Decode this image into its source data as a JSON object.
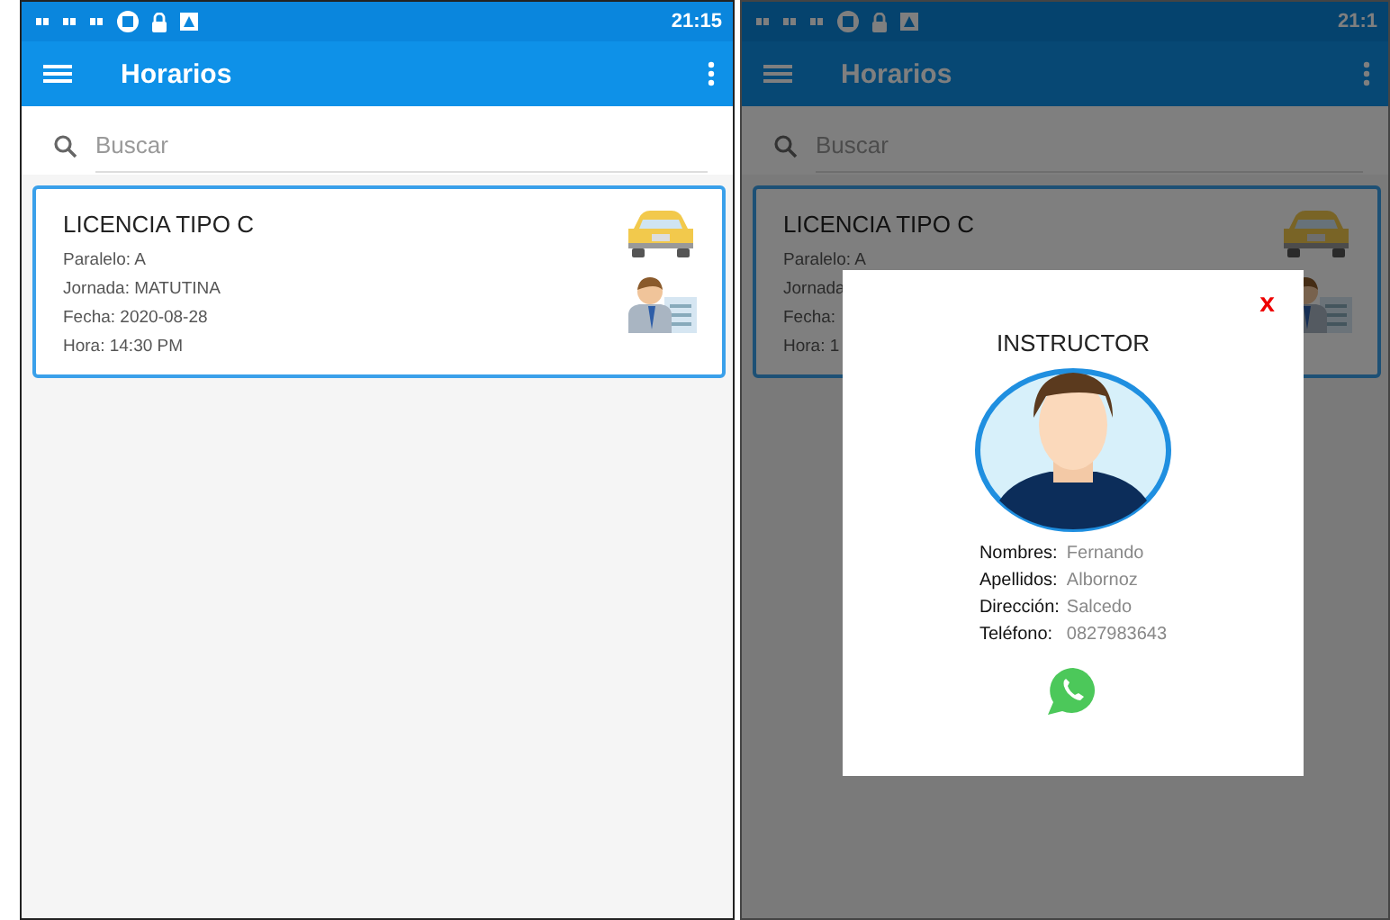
{
  "screens": [
    {
      "dimmed": false,
      "status_time": "21:15",
      "title": "Horarios",
      "search": {
        "placeholder": "Buscar"
      },
      "card": {
        "title": "LICENCIA TIPO C",
        "lines": [
          "Paralelo: A",
          "Jornada: MATUTINA",
          "Fecha: 2020-08-28",
          "Hora: 14:30 PM"
        ]
      }
    },
    {
      "dimmed": true,
      "status_time": "21:1",
      "title": "Horarios",
      "search": {
        "placeholder": "Buscar"
      },
      "card": {
        "title": "LICENCIA TIPO C",
        "lines": [
          "Paralelo: A",
          "Jornada",
          "Fecha:",
          "Hora: 1"
        ]
      },
      "dialog": {
        "close": "x",
        "title": "INSTRUCTOR",
        "fields": [
          {
            "label": "Nombres:",
            "value": "Fernando"
          },
          {
            "label": "Apellidos:",
            "value": "Albornoz"
          },
          {
            "label": "Dirección:",
            "value": "Salcedo"
          },
          {
            "label": "Teléfono:",
            "value": "0827983643"
          }
        ]
      }
    }
  ]
}
